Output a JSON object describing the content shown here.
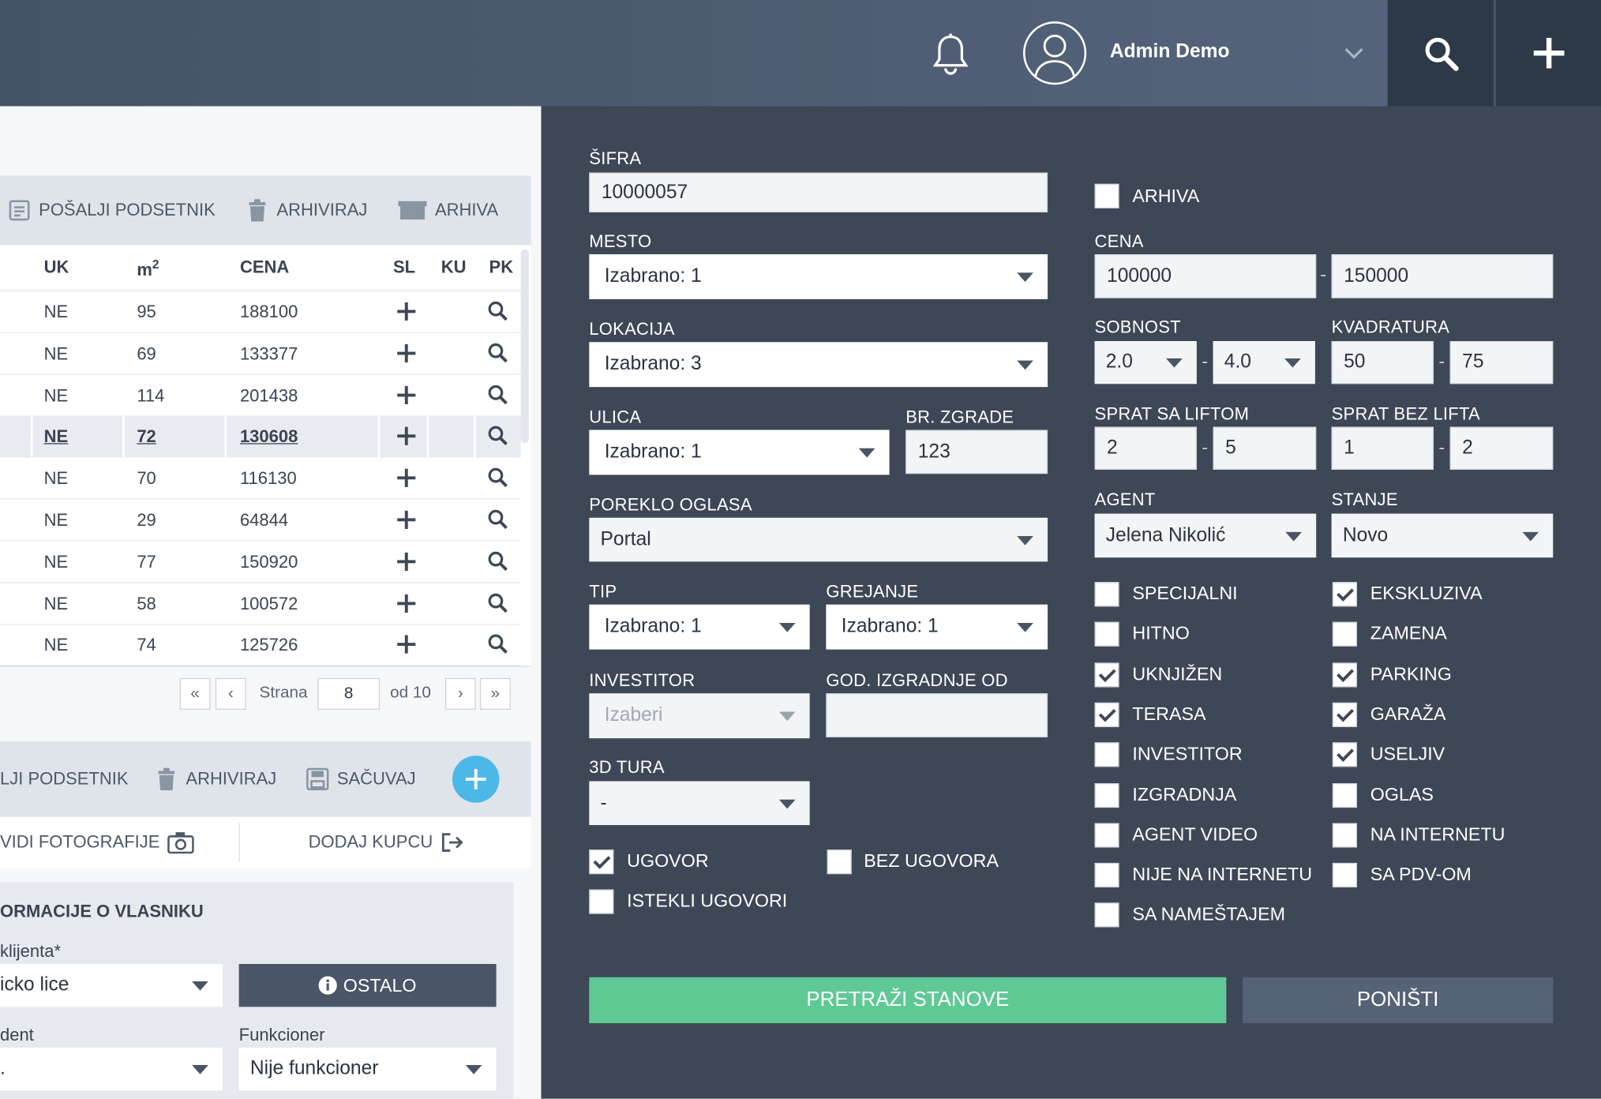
{
  "header": {
    "user_name": "Admin Demo"
  },
  "left": {
    "toolbar1": {
      "send_reminder": "POŠALJI PODSETNIK",
      "archive": "ARHIVIRAJ",
      "archive_list": "ARHIVA"
    },
    "table": {
      "columns": [
        "UK",
        "m",
        "CENA",
        "SL",
        "KU",
        "PK"
      ],
      "m_sup": "2",
      "rows": [
        {
          "uk": "NE",
          "m2": "95",
          "cena": "188100"
        },
        {
          "uk": "NE",
          "m2": "69",
          "cena": "133377"
        },
        {
          "uk": "NE",
          "m2": "114",
          "cena": "201438"
        },
        {
          "uk": "NE",
          "m2": "72",
          "cena": "130608"
        },
        {
          "uk": "NE",
          "m2": "70",
          "cena": "116130"
        },
        {
          "uk": "NE",
          "m2": "29",
          "cena": "64844"
        },
        {
          "uk": "NE",
          "m2": "77",
          "cena": "150920"
        },
        {
          "uk": "NE",
          "m2": "58",
          "cena": "100572"
        },
        {
          "uk": "NE",
          "m2": "74",
          "cena": "125726"
        }
      ]
    },
    "pagination": {
      "first": "«",
      "prev": "‹",
      "page_label": "Strana",
      "page_value": "8",
      "of_label": "od 10",
      "next": "›",
      "last": "»"
    },
    "toolbar2": {
      "send_reminder": "LJI PODSETNIK",
      "archive": "ARHIVIRAJ",
      "save": "SAČUVAJ"
    },
    "links": {
      "photos": "VIDI FOTOGRAFIJE",
      "add_buyer": "DODAJ KUPCU"
    },
    "owner": {
      "title": "ORMACIJE O VLASNIKU",
      "client_label": "klijenta*",
      "client_value": "icko lice",
      "other_button": "OSTALO",
      "resident_label": "dent",
      "resident_value": ".",
      "official_label": "Funkcioner",
      "official_value": "Nije funkcioner"
    }
  },
  "filter": {
    "sifra_label": "ŠIFRA",
    "sifra_value": "10000057",
    "arhiva_label": "ARHIVA",
    "mesto_label": "MESTO",
    "mesto_value": "Izabrano: 1",
    "cena_label": "CENA",
    "cena_from": "100000",
    "cena_to": "150000",
    "lokacija_label": "LOKACIJA",
    "lokacija_value": "Izabrano: 3",
    "sobnost_label": "SOBNOST",
    "sobnost_from": "2.0",
    "sobnost_to": "4.0",
    "kvadratura_label": "KVADRATURA",
    "kvadratura_from": "50",
    "kvadratura_to": "75",
    "ulica_label": "ULICA",
    "ulica_value": "Izabrano: 1",
    "br_zgrade_label": "BR. ZGRADE",
    "br_zgrade_value": "123",
    "sprat_lift_label": "SPRAT SA LIFTOM",
    "sprat_lift_from": "2",
    "sprat_lift_to": "5",
    "sprat_bez_label": "SPRAT BEZ LIFTA",
    "sprat_bez_from": "1",
    "sprat_bez_to": "2",
    "poreklo_label": "POREKLO OGLASA",
    "poreklo_value": "Portal",
    "agent_label": "AGENT",
    "agent_value": "Jelena Nikolić",
    "stanje_label": "STANJE",
    "stanje_value": "Novo",
    "tip_label": "TIP",
    "tip_value": "Izabrano: 1",
    "grejanje_label": "GREJANJE",
    "grejanje_value": "Izabrano: 1",
    "investitor_label": "INVESTITOR",
    "investitor_placeholder": "Izaberi",
    "god_label": "GOD. IZGRADNJE OD",
    "tura_label": "3D TURA",
    "tura_value": "-",
    "ugovor_label": "UGOVOR",
    "bez_ugovora_label": "BEZ UGOVORA",
    "istekli_label": "ISTEKLI UGOVORI",
    "flags_left": [
      {
        "label": "SPECIJALNI",
        "checked": false
      },
      {
        "label": "HITNO",
        "checked": false
      },
      {
        "label": "UKNJIŽEN",
        "checked": true
      },
      {
        "label": "TERASA",
        "checked": true
      },
      {
        "label": "INVESTITOR",
        "checked": false
      },
      {
        "label": "IZGRADNJA",
        "checked": false
      },
      {
        "label": "AGENT VIDEO",
        "checked": false
      },
      {
        "label": "NIJE NA INTERNETU",
        "checked": false
      },
      {
        "label": "SA NAMEŠTAJEM",
        "checked": false
      }
    ],
    "flags_right": [
      {
        "label": "EKSKLUZIVA",
        "checked": true
      },
      {
        "label": "ZAMENA",
        "checked": false
      },
      {
        "label": "PARKING",
        "checked": true
      },
      {
        "label": "GARAŽA",
        "checked": true
      },
      {
        "label": "USELJIV",
        "checked": true
      },
      {
        "label": "OGLAS",
        "checked": false
      },
      {
        "label": "NA INTERNETU",
        "checked": false
      },
      {
        "label": "SA PDV-OM",
        "checked": false
      }
    ],
    "search_button": "PRETRAŽI STANOVE",
    "reset_button": "PONIŠTI"
  }
}
